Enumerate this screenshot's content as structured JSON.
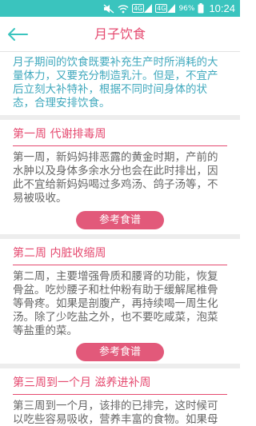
{
  "status_bar": {
    "battery_percent": "96%",
    "time": "10:24",
    "icons": [
      "mute-icon",
      "wifi-icon",
      "signal-icon",
      "signal-icon",
      "battery-icon"
    ]
  },
  "header": {
    "title": "月子饮食",
    "back_icon": "back-arrow-icon"
  },
  "intro": "月子期间的饮食既要补充生产时所消耗的大量体力，又要充分制造乳汁。但是，不宜产后立刻大补特补，根据不同时间身体的状态，合理安排饮食。",
  "sections": [
    {
      "title": "第一周 代谢排毒周",
      "body": "第一周，新妈妈排恶露的黄金时期，产前的水肿以及身体多余水分也会在此时排出，因此不宜给新妈妈喝过多鸡汤、鸽子汤等，不易被吸收。",
      "button": "参考食谱"
    },
    {
      "title": "第二周 内脏收缩周",
      "body": "第二周，主要增强骨质和腰肾的功能，恢复骨盆。吃炒腰子和杜仲粉有助于缓解尾椎骨等骨疼。如果是剖腹产，再持续喝一周生化汤。除了少吃盐之外，也不要吃咸菜，泡菜等盐重的菜。",
      "button": "参考食谱"
    },
    {
      "title": "第三周到一个月 滋养进补周",
      "body": "第三周到一个月，该排的已排完，这时候可以吃些容易吸收，营养丰富的食物。如果母乳不够，可以适当吃些下奶食物，如鲫鱼汤"
    }
  ],
  "colors": {
    "status_bar": "#3ac4be",
    "accent": "#e5496f",
    "button": "#e2597a",
    "intro_text": "#3fa8bd",
    "back_icon": "#3ac4be"
  }
}
